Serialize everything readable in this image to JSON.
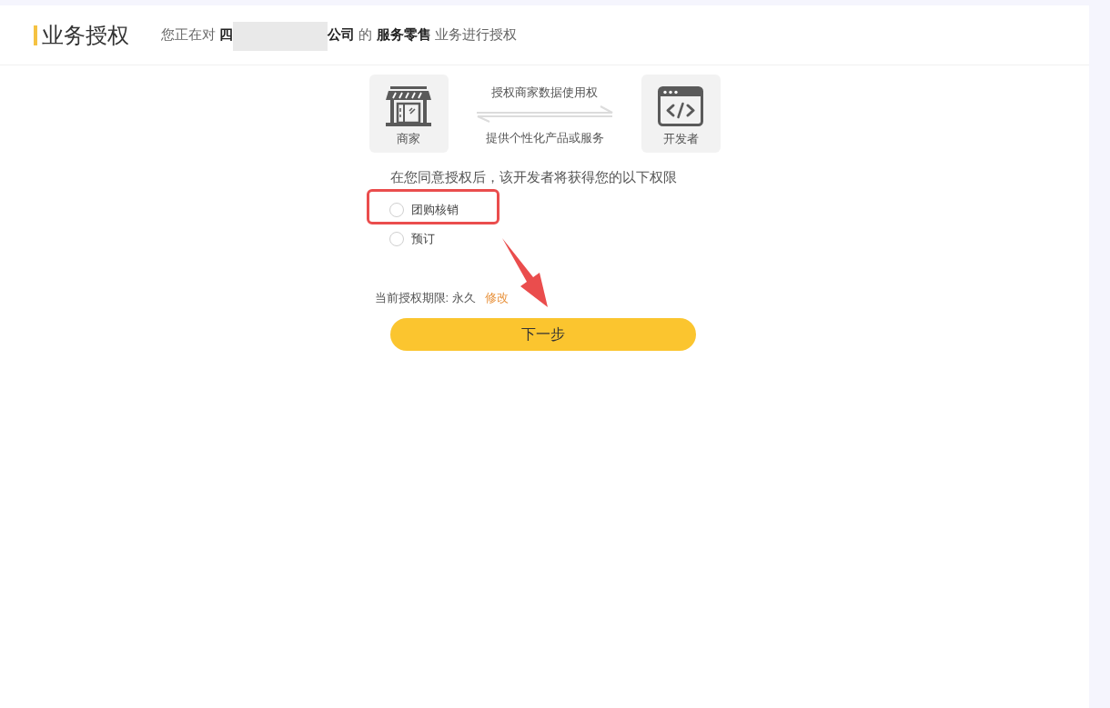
{
  "header": {
    "title": "业务授权",
    "subtitle_start": "您正在对 **四**",
    "redacted": true,
    "subtitle_end": "**公司** 的 **服务零售** 业务进行授权"
  },
  "diagram": {
    "merchant_label": "商家",
    "developer_label": "开发者",
    "forward_label": "授权商家数据使用权",
    "backward_label": "提供个性化产品或服务"
  },
  "permissions": {
    "heading": "在您同意授权后，该开发者将获得您的以下权限",
    "items": [
      {
        "label": "团购核销",
        "checked": false,
        "highlighted": true
      },
      {
        "label": "预订",
        "checked": false,
        "highlighted": false
      }
    ]
  },
  "period": {
    "label": "当前授权期限: 永久",
    "action": "修改"
  },
  "next_button": {
    "label": "下一步"
  }
}
